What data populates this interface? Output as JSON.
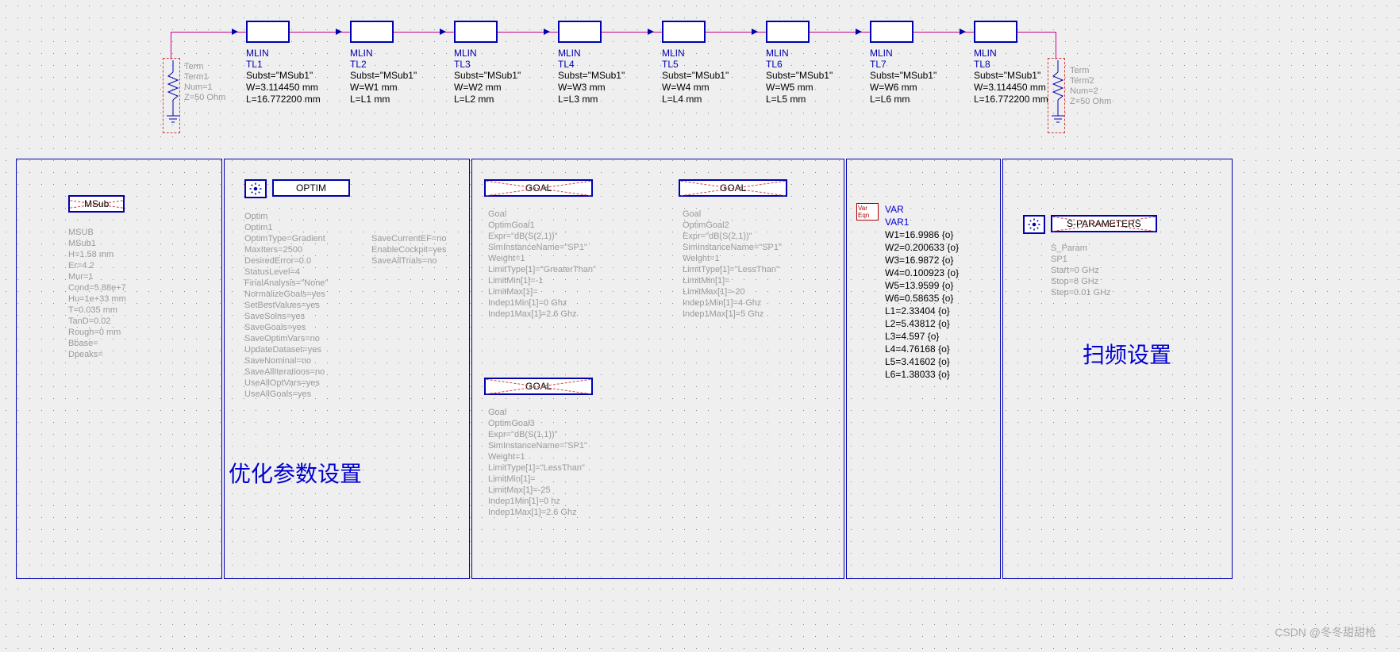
{
  "term1": {
    "name": "Term",
    "inst": "Term1",
    "num": "Num=1",
    "z": "Z=50 Ohm"
  },
  "term2": {
    "name": "Term",
    "inst": "Term2",
    "num": "Num=2",
    "z": "Z=50 Ohm"
  },
  "mlins": [
    {
      "type": "MLIN",
      "name": "TL1",
      "subst": "Subst=\"MSub1\"",
      "w": "W=3.114450 mm",
      "l": "L=16.772200 mm"
    },
    {
      "type": "MLIN",
      "name": "TL2",
      "subst": "Subst=\"MSub1\"",
      "w": "W=W1 mm",
      "l": "L=L1 mm"
    },
    {
      "type": "MLIN",
      "name": "TL3",
      "subst": "Subst=\"MSub1\"",
      "w": "W=W2 mm",
      "l": "L=L2 mm"
    },
    {
      "type": "MLIN",
      "name": "TL4",
      "subst": "Subst=\"MSub1\"",
      "w": "W=W3 mm",
      "l": "L=L3 mm"
    },
    {
      "type": "MLIN",
      "name": "TL5",
      "subst": "Subst=\"MSub1\"",
      "w": "W=W4 mm",
      "l": "L=L4 mm"
    },
    {
      "type": "MLIN",
      "name": "TL6",
      "subst": "Subst=\"MSub1\"",
      "w": "W=W5 mm",
      "l": "L=L5 mm"
    },
    {
      "type": "MLIN",
      "name": "TL7",
      "subst": "Subst=\"MSub1\"",
      "w": "W=W6 mm",
      "l": "L=L6 mm"
    },
    {
      "type": "MLIN",
      "name": "TL8",
      "subst": "Subst=\"MSub1\"",
      "w": "W=3.114450 mm",
      "l": "L=16.772200 mm"
    }
  ],
  "msub": {
    "title": "MSub",
    "lines": [
      "MSUB",
      "MSub1",
      "H=1.58 mm",
      "Er=4.2",
      "Mur=1",
      "Cond=5.88e+7",
      "Hu=1e+33 mm",
      "T=0.035 mm",
      "TanD=0.02",
      "Rough=0 mm",
      "Bbase=",
      "Dpeaks="
    ]
  },
  "optim": {
    "title": "OPTIM",
    "col1": [
      "Optim",
      "Optim1",
      "OptimType=Gradient",
      "MaxIters=2500",
      "DesiredError=0.0",
      "StatusLevel=4",
      "FinalAnalysis=\"None\"",
      "NormalizeGoals=yes",
      "SetBestValues=yes",
      "SaveSolns=yes",
      "SaveGoals=yes",
      "SaveOptimVars=no",
      "UpdateDataset=yes",
      "SaveNominal=no",
      "SaveAllIterations=no",
      "UseAllOptVars=yes",
      "UseAllGoals=yes"
    ],
    "col2": [
      "SaveCurrentEF=no",
      "EnableCockpit=yes",
      "SaveAllTrials=no"
    ],
    "anno": "优化参数设置"
  },
  "goal1": {
    "title": "GOAL",
    "lines": [
      "Goal",
      "OptimGoal1",
      "Expr=\"dB(S(2,1))\"",
      "SimInstanceName=\"SP1\"",
      "Weight=1",
      "LimitType[1]=\"GreaterThan\"",
      "LimitMin[1]=-1",
      "LimitMax[1]=",
      "Indep1Min[1]=0 Ghz",
      "Indep1Max[1]=2.6 Ghz"
    ]
  },
  "goal2": {
    "title": "GOAL",
    "lines": [
      "Goal",
      "OptimGoal2",
      "Expr=\"dB(S(2,1))\"",
      "SimInstanceName=\"SP1\"",
      "Weight=1",
      "LimitType[1]=\"LessThan\"",
      "LimitMin[1]=",
      "LimitMax[1]=-20",
      "Indep1Min[1]=4 Ghz",
      "Indep1Max[1]=5 Ghz"
    ]
  },
  "goal3": {
    "title": "GOAL",
    "lines": [
      "Goal",
      "OptimGoal3",
      "Expr=\"dB(S(1,1))\"",
      "SimInstanceName=\"SP1\"",
      "Weight=1",
      "LimitType[1]=\"LessThan\"",
      "LimitMin[1]=",
      "LimitMax[1]=-25",
      "Indep1Min[1]=0 hz",
      "Indep1Max[1]=2.6 Ghz"
    ]
  },
  "var": {
    "title": "VAR",
    "inst": "VAR1",
    "lines": [
      "W1=16.9986 {o}",
      "W2=0.200633 {o}",
      "W3=16.9872 {o}",
      "W4=0.100923 {o}",
      "W5=13.9599 {o}",
      "W6=0.58635 {o}",
      "L1=2.33404 {o}",
      "L2=5.43812 {o}",
      "L3=4.597 {o}",
      "L4=4.76168 {o}",
      "L5=3.41602 {o}",
      "L6=1.38033 {o}"
    ]
  },
  "sparam": {
    "title": "S-PARAMETERS",
    "lines": [
      "S_Param",
      "SP1",
      "Start=0 GHz",
      "Stop=6 GHz",
      "Step=0.01 GHz"
    ],
    "anno": "扫频设置"
  },
  "watermark": "CSDN @冬冬甜甜枪"
}
